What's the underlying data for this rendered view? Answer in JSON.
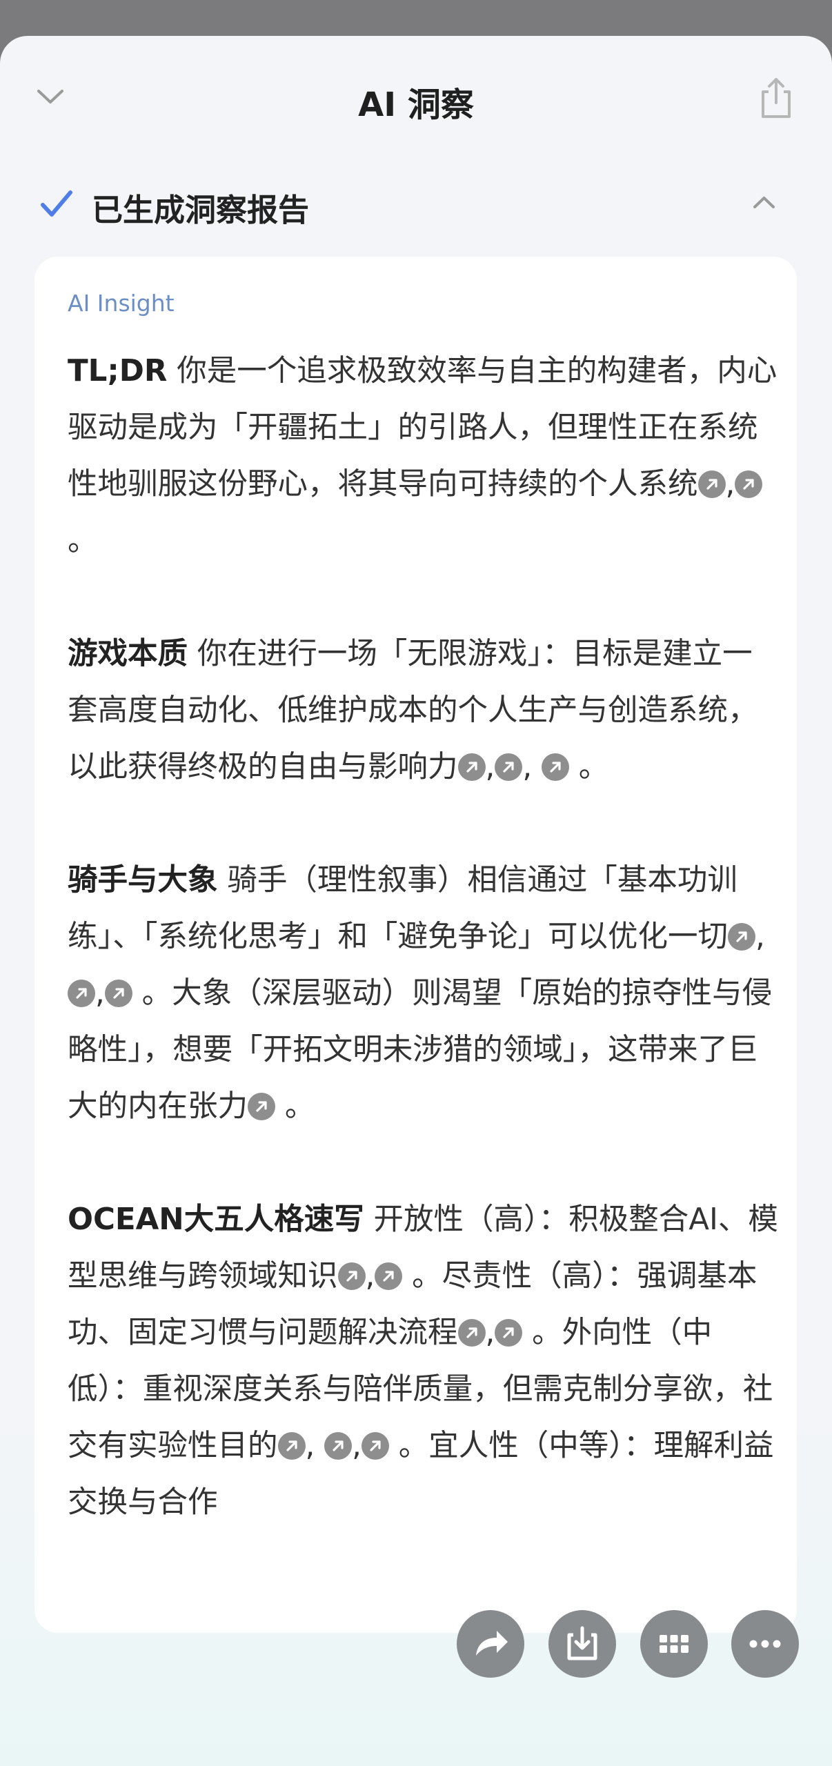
{
  "header": {
    "title": "AI 洞察",
    "collapse_icon": "chevron-down-icon",
    "share_icon": "share-icon"
  },
  "status": {
    "text": "已生成洞察报告",
    "icon": "check-icon",
    "accent": "#4f7ee8",
    "toggle_icon": "chevron-up-icon"
  },
  "card": {
    "label": "AI Insight",
    "label_color": "#6b8fc4"
  },
  "paragraphs": [
    {
      "heading": "TL;DR",
      "segments": [
        {
          "t": " 你是一个追求极致效率与自主的构建者，内心驱动是成为「开疆拓土」的引路人，但理性正在系统性地驯服这份野心，将其导向可持续的个人系统"
        },
        {
          "c": true
        },
        {
          "t": ","
        },
        {
          "c": true
        },
        {
          "t": " 。"
        }
      ]
    },
    {
      "heading": "游戏本质",
      "segments": [
        {
          "t": " 你在进行一场「无限游戏」：目标是建立一套高度自动化、低维护成本的个人生产与创造系统，以此获得终极的自由与影响力"
        },
        {
          "c": true
        },
        {
          "t": ","
        },
        {
          "c": true
        },
        {
          "t": ", "
        },
        {
          "c": true
        },
        {
          "t": " 。"
        }
      ]
    },
    {
      "heading": "骑手与大象",
      "segments": [
        {
          "t": " 骑手（理性叙事）相信通过「基本功训练」、「系统化思考」和「避免争论」可以优化一切"
        },
        {
          "c": true
        },
        {
          "t": ","
        },
        {
          "c": true
        },
        {
          "t": ","
        },
        {
          "c": true
        },
        {
          "t": " 。大象（深层驱动）则渴望「原始的掠夺性与侵略性」，想要「开拓文明未涉猎的领域」，这带来了巨大的内在张力"
        },
        {
          "c": true
        },
        {
          "t": " 。"
        }
      ]
    },
    {
      "heading": "OCEAN大五人格速写",
      "segments": [
        {
          "t": " 开放性（高）：积极整合AI、模型思维与跨领域知识"
        },
        {
          "c": true
        },
        {
          "t": ","
        },
        {
          "c": true
        },
        {
          "t": " 。尽责性（高）：强调基本功、固定习惯与问题解决流程"
        },
        {
          "c": true
        },
        {
          "t": ","
        },
        {
          "c": true
        },
        {
          "t": " 。外向性（中低）：重视深度关系与陪伴质量，但需克制分享欲，社交有实验性目的"
        },
        {
          "c": true
        },
        {
          "t": ", "
        },
        {
          "c": true
        },
        {
          "t": ","
        },
        {
          "c": true
        },
        {
          "t": " 。宜人性（中等）：理解利益交换与合作"
        }
      ]
    }
  ],
  "cite_icon": "arrow-up-right-icon",
  "fabs": [
    {
      "name": "forward-button",
      "icon": "forward-arrow-icon"
    },
    {
      "name": "download-button",
      "icon": "download-icon"
    },
    {
      "name": "apps-button",
      "icon": "grid-icon"
    },
    {
      "name": "more-button",
      "icon": "more-horizontal-icon"
    }
  ]
}
